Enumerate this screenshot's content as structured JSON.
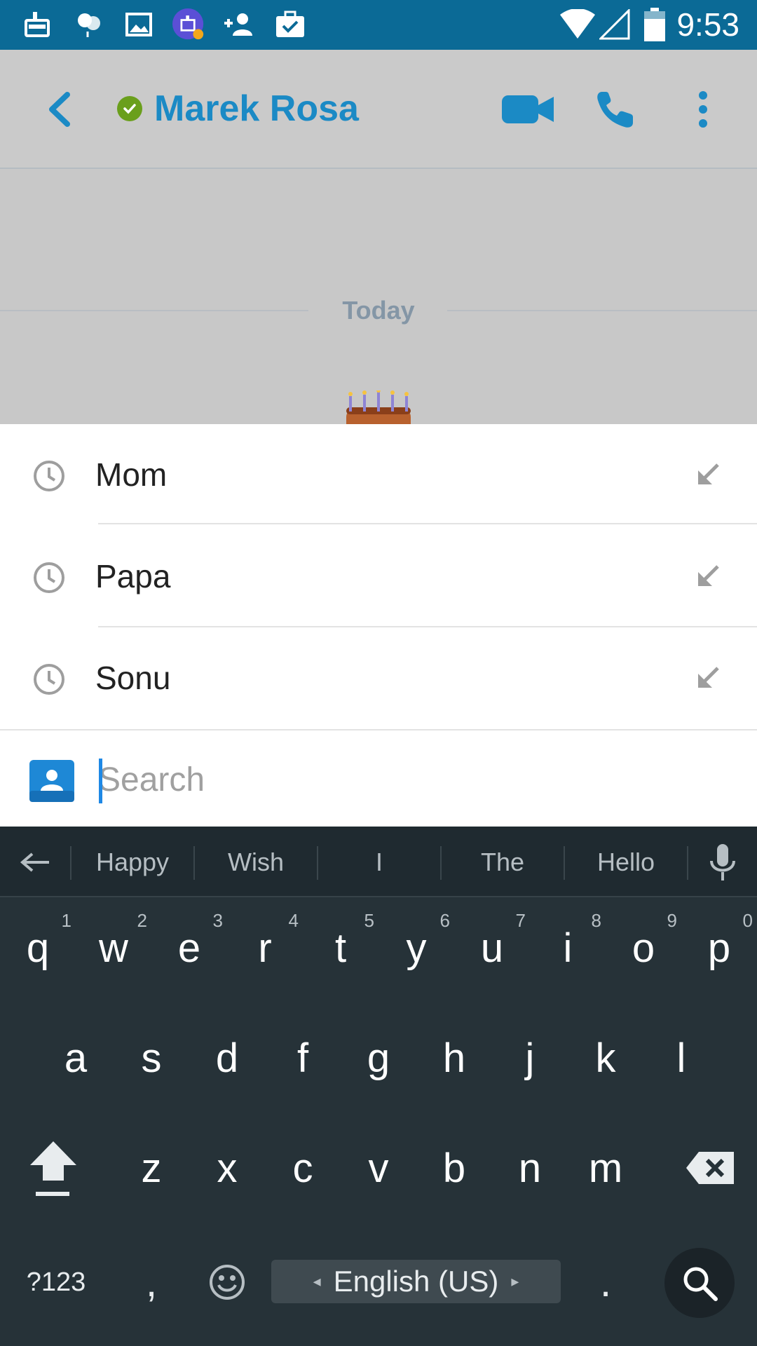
{
  "status_bar": {
    "time": "9:53",
    "icons": [
      "cleaner-icon",
      "balloons-icon",
      "gallery-icon",
      "app-notification-icon",
      "add-contact-icon",
      "task-icon",
      "wifi-icon",
      "signal-icon",
      "battery-icon"
    ]
  },
  "header": {
    "contact_name": "Marek Rosa",
    "presence": "online",
    "accent_color": "#1b8ac5",
    "presence_color": "#6a9f1c"
  },
  "conversation": {
    "date_divider": "Today"
  },
  "suggestions": [
    {
      "label": "Mom"
    },
    {
      "label": "Papa"
    },
    {
      "label": "Sonu"
    }
  ],
  "search": {
    "placeholder": "Search",
    "value": ""
  },
  "keyboard": {
    "word_suggestions": [
      "Happy",
      "Wish",
      "I",
      "The",
      "Hello"
    ],
    "row1": [
      "q",
      "w",
      "e",
      "r",
      "t",
      "y",
      "u",
      "i",
      "o",
      "p"
    ],
    "row1_hints": [
      "1",
      "2",
      "3",
      "4",
      "5",
      "6",
      "7",
      "8",
      "9",
      "0"
    ],
    "row2": [
      "a",
      "s",
      "d",
      "f",
      "g",
      "h",
      "j",
      "k",
      "l"
    ],
    "row3": [
      "z",
      "x",
      "c",
      "v",
      "b",
      "n",
      "m"
    ],
    "symbols_key": "?123",
    "comma_key": ",",
    "period_key": ".",
    "language_label": "English (US)"
  }
}
